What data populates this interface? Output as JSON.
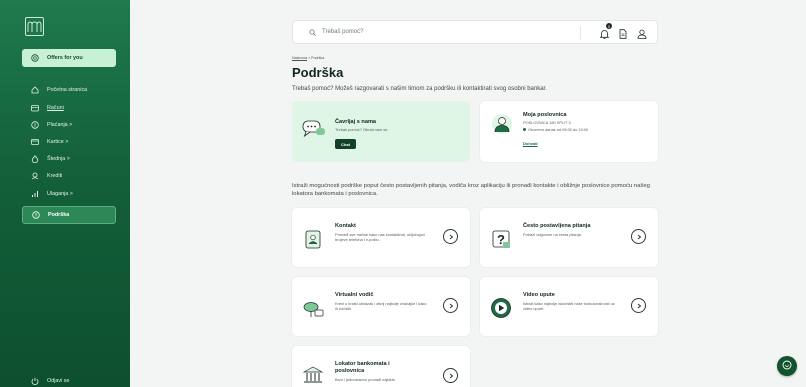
{
  "sidebar": {
    "items": [
      {
        "label": "Offers for you",
        "icon": "offers-icon"
      },
      {
        "label": "Početna stranica",
        "icon": "home-icon"
      },
      {
        "label": "Računi",
        "icon": "wallet-icon"
      },
      {
        "label": "Plaćanja >",
        "icon": "payments-icon"
      },
      {
        "label": "Kartice >",
        "icon": "card-icon"
      },
      {
        "label": "Štednja >",
        "icon": "savings-icon"
      },
      {
        "label": "Krediti",
        "icon": "loan-icon"
      },
      {
        "label": "Ulaganja >",
        "icon": "investments-icon"
      },
      {
        "label": "Podrška",
        "icon": "support-icon"
      }
    ],
    "logout_label": "Odjavi se"
  },
  "search": {
    "placeholder": "Trebaš pomoć?",
    "notification_count": "0"
  },
  "breadcrumb": {
    "home": "Naslovna",
    "separator": ">",
    "current": "Podrška"
  },
  "page": {
    "title": "Podrška",
    "subtitle": "Trebaš pomoć? Možeš razgovarati s našim timom za podršku ili kontaktirati svog osobni bankar.",
    "intro": "Istraži mogućnosti podrške poput često postavljenih pitanja, vodiča kroz aplikaciju ili pronađi kontakte i obližnje poslovnice pomoću našeg lokatora bankomata i poslovnica."
  },
  "chat_card": {
    "title": "Čavrljaj s nama",
    "text": "Trebaš pomoć? Obrati nam se.",
    "button": "Chat"
  },
  "branch_card": {
    "title": "Moja poslovnica",
    "address": "POSLOVNICA 180 SPLIT 3",
    "status": "Otvoreno danas od 08:00 do 15:00",
    "link": "Dohvati"
  },
  "tiles": [
    {
      "title": "Kontakt",
      "text": "Pronađi sve načine kako nas kontaktirati, uključujući brojeve telefona i e-poštu."
    },
    {
      "title": "Često postavljena pitanja",
      "text": "Potraži odgovore na česta pitanja."
    },
    {
      "title": "Virtualni vodič",
      "text": "Kreni u kratki obilazak i otkrij najbolje značajke i kako ih koristiti"
    },
    {
      "title": "Video upute",
      "text": "Istraži kako najbolje iskoristiti naše funkcionalnosti uz video upute."
    },
    {
      "title": "Lokator bankomata i poslovnica",
      "text": "Brzo i jednostavno pronađi najbližu"
    }
  ],
  "colors": {
    "sidebar": "#13603a",
    "accent": "#c8f1d4",
    "chat_card": "#dff6e7",
    "dark_green": "#12402a"
  }
}
